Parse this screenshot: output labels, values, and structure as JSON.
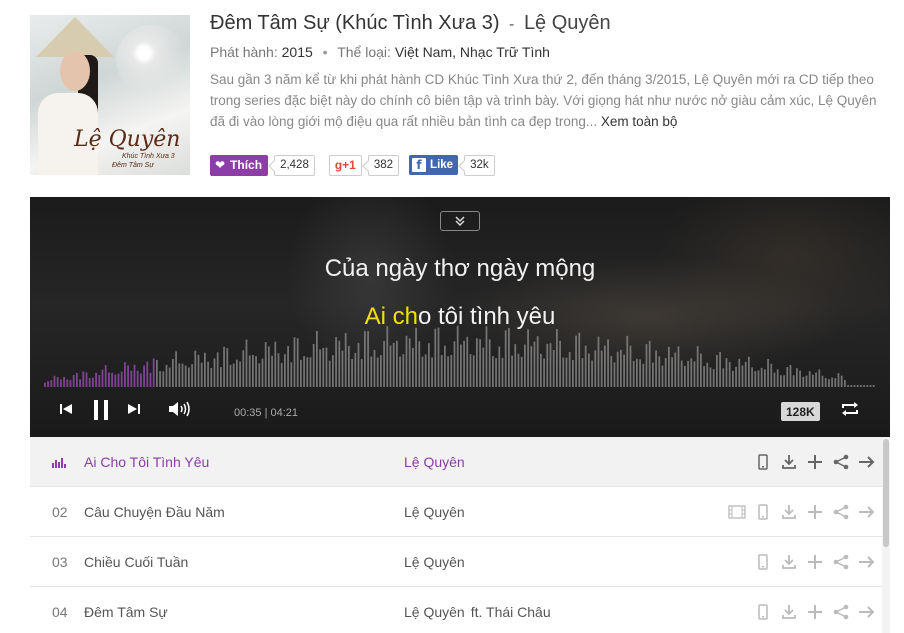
{
  "album": {
    "title": "Đêm Tâm Sự (Khúc Tình Xưa 3)",
    "separator": "-",
    "artist": "Lệ Quyên",
    "release_label": "Phát hành:",
    "release_year": "2015",
    "genre_label": "Thể loại:",
    "genres": "Việt Nam, Nhạc Trữ Tình",
    "description": "Sau gần 3 năm kể từ khi phát hành CD Khúc Tình Xưa thứ 2, đến tháng 3/2015, Lệ Quyên mới ra CD tiếp theo trong series đặc biệt này do chính cô biên tập và trình bày. Với giọng hát như nước nở giàu cảm xúc, Lệ Quyên đã đi vào lòng giới mộ điệu qua rất nhiều bản tình ca đẹp trong...",
    "more_link": "Xem toàn bộ",
    "cover": {
      "signature": "Lệ Quyên",
      "subtitle": "Khúc Tình Xưa 3",
      "subtitle2": "Đêm Tâm Sự"
    }
  },
  "social": {
    "like_label": "Thích",
    "like_count": "2,428",
    "gplus_label": "g+1",
    "gplus_count": "382",
    "fb_label": "Like",
    "fb_count": "32k"
  },
  "player": {
    "lyric_line1": "Của ngày thơ ngày mộng",
    "lyric_line2_highlight": "Ai ch",
    "lyric_line2_rest": "o tôi tình yêu",
    "current_time": "00:35",
    "time_separator": "|",
    "total_time": "04:21",
    "progress": 0.134,
    "quality": "128K",
    "colors": {
      "played": "#9a4fb5",
      "unplayed": "#8a8a8a",
      "highlight": "#f5e000"
    }
  },
  "tracks": [
    {
      "num": "",
      "name": "Ai Cho Tôi Tình Yêu",
      "artist": "Lệ Quyên",
      "feat": "",
      "playing": true,
      "has_mv": false
    },
    {
      "num": "02",
      "name": "Câu Chuyện Đầu Năm",
      "artist": "Lệ Quyên",
      "feat": "",
      "playing": false,
      "has_mv": true
    },
    {
      "num": "03",
      "name": "Chiều Cuối Tuần",
      "artist": "Lệ Quyên",
      "feat": "",
      "playing": false,
      "has_mv": false
    },
    {
      "num": "04",
      "name": "Đêm Tâm Sự",
      "artist": "Lệ Quyên",
      "feat": "ft. Thái Châu",
      "playing": false,
      "has_mv": false
    }
  ],
  "icons": {
    "track_actions": [
      "mobile-icon",
      "download-icon",
      "add-icon",
      "share-icon",
      "arrow-right-icon"
    ],
    "mv": "video-icon",
    "controls": [
      "previous-icon",
      "pause-icon",
      "next-icon",
      "volume-icon",
      "repeat-icon",
      "collapse-icon"
    ]
  }
}
